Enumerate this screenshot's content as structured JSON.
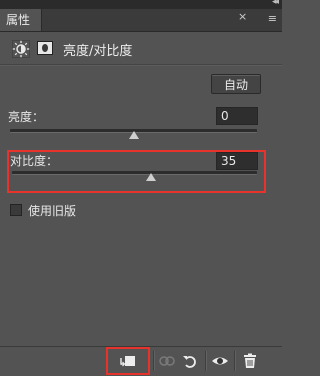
{
  "panel": {
    "tab_label": "属性",
    "close_symbol": "×",
    "menu_symbol": "≡",
    "collapse_symbol": "◂◂",
    "title": "亮度/对比度"
  },
  "controls": {
    "auto_label": "自动",
    "brightness_label": "亮度：",
    "brightness_value": "0",
    "brightness_level": 0,
    "contrast_label": "对比度：",
    "contrast_value": "35",
    "contrast_level": 35,
    "legacy_label": "使用旧版",
    "legacy_checked": false
  },
  "icons": {
    "adjustment": "brightness-contrast-icon",
    "mask": "layer-mask-icon",
    "clip": "clip-to-layer-icon",
    "view_previous": "view-previous-state-icon",
    "reset": "reset-icon",
    "visibility": "eye-icon",
    "delete": "trash-icon"
  },
  "colors": {
    "panel_bg": "#535353",
    "highlight": "#e8332d"
  }
}
